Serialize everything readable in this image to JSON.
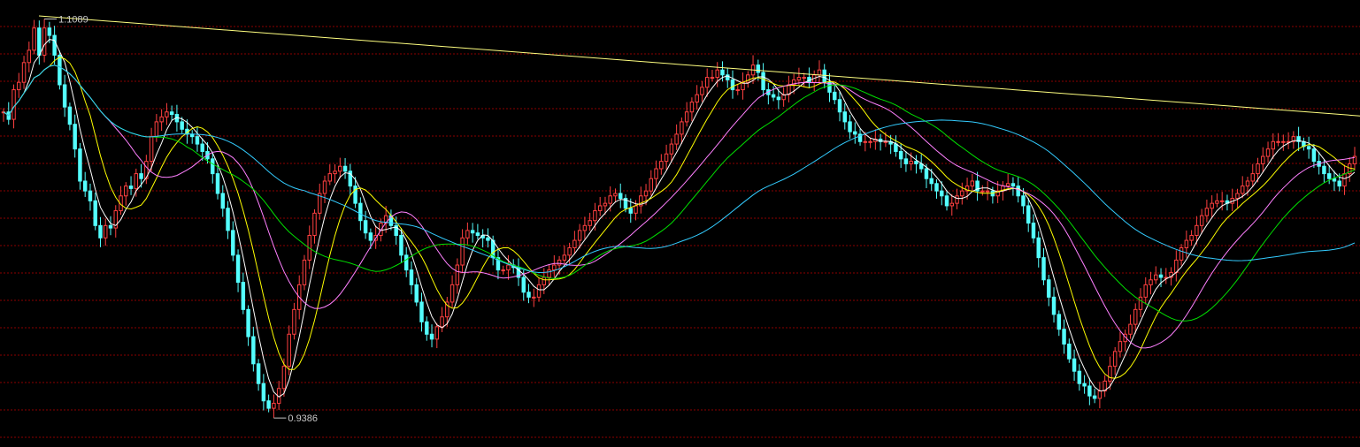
{
  "chart_data": {
    "type": "candlestick",
    "y_max_label": "1.1089",
    "y_min_label": "0.9386",
    "ylim": [
      0.9386,
      1.1089
    ],
    "grid": true,
    "colors": {
      "background": "#000000",
      "grid": "#8b0000",
      "up": "#ff4040",
      "down": "#54ffff",
      "trendline": "#ffff80",
      "ma5": "#ffffff",
      "ma10": "#ffff00",
      "ma20": "#ff80ff",
      "ma30": "#00e000",
      "ma60": "#33ccff"
    },
    "trendline": {
      "start": [
        0,
        1.1089
      ],
      "end": [
        399,
        1.0684
      ]
    },
    "close": [
      1.07,
      1.067,
      1.079,
      1.082,
      1.09,
      1.095,
      1.104,
      1.093,
      1.104,
      1.101,
      1.093,
      1.081,
      1.072,
      1.065,
      1.055,
      1.042,
      1.038,
      1.034,
      1.024,
      1.019,
      1.024,
      1.023,
      1.03,
      1.036,
      1.04,
      1.039,
      1.045,
      1.043,
      1.05,
      1.06,
      1.066,
      1.068,
      1.07,
      1.069,
      1.066,
      1.063,
      1.061,
      1.06,
      1.057,
      1.054,
      1.051,
      1.045,
      1.037,
      1.031,
      1.022,
      1.012,
      1.001,
      0.99,
      0.979,
      0.968,
      0.96,
      0.953,
      0.95,
      0.952,
      0.958,
      0.967,
      0.98,
      0.99,
      1.0,
      1.01,
      1.02,
      1.029,
      1.037,
      1.042,
      1.045,
      1.046,
      1.048,
      1.046,
      1.04,
      1.033,
      1.026,
      1.021,
      1.018,
      1.02,
      1.025,
      1.028,
      1.024,
      1.02,
      1.012,
      1.006,
      1.0,
      0.993,
      0.985,
      0.98,
      0.978,
      0.983,
      0.987,
      0.993,
      1.0,
      1.008,
      1.019,
      1.022,
      1.021,
      1.02,
      1.019,
      1.018,
      1.011,
      1.006,
      1.006,
      1.008,
      1.007,
      1.003,
      0.997,
      0.995,
      0.995,
      1.0,
      1.003,
      1.006,
      1.008,
      1.01,
      1.012,
      1.015,
      1.018,
      1.022,
      1.024,
      1.026,
      1.03,
      1.032,
      1.033,
      1.036,
      1.037,
      1.035,
      1.031,
      1.029,
      1.032,
      1.036,
      1.038,
      1.043,
      1.047,
      1.05,
      1.053,
      1.057,
      1.061,
      1.066,
      1.07,
      1.074,
      1.077,
      1.08,
      1.084,
      1.084,
      1.087,
      1.085,
      1.083,
      1.079,
      1.079,
      1.082,
      1.085,
      1.089,
      1.086,
      1.079,
      1.077,
      1.076,
      1.075,
      1.077,
      1.081,
      1.083,
      1.084,
      1.084,
      1.082,
      1.085,
      1.087,
      1.082,
      1.078,
      1.075,
      1.07,
      1.066,
      1.062,
      1.061,
      1.058,
      1.058,
      1.058,
      1.059,
      1.058,
      1.058,
      1.057,
      1.054,
      1.051,
      1.049,
      1.05,
      1.049,
      1.047,
      1.043,
      1.041,
      1.038,
      1.036,
      1.032,
      1.033,
      1.036,
      1.038,
      1.04,
      1.042,
      1.038,
      1.038,
      1.038,
      1.036,
      1.038,
      1.04,
      1.041,
      1.04,
      1.036,
      1.032,
      1.025,
      1.019,
      1.011,
      1.002,
      0.995,
      0.988,
      0.982,
      0.976,
      0.97,
      0.965,
      0.96,
      0.959,
      0.955,
      0.954,
      0.957,
      0.961,
      0.967,
      0.973,
      0.977,
      0.98,
      0.984,
      0.99,
      0.995,
      1.0,
      1.002,
      1.004,
      1.003,
      1.003,
      1.005,
      1.01,
      1.015,
      1.018,
      1.02,
      1.024,
      1.028,
      1.031,
      1.033,
      1.034,
      1.034,
      1.033,
      1.035,
      1.037,
      1.04,
      1.042,
      1.045,
      1.049,
      1.052,
      1.055,
      1.058,
      1.058,
      1.058,
      1.058,
      1.06,
      1.058,
      1.056,
      1.055,
      1.05,
      1.048,
      1.045,
      1.043,
      1.042,
      1.04,
      1.045,
      1.049,
      1.052
    ]
  }
}
